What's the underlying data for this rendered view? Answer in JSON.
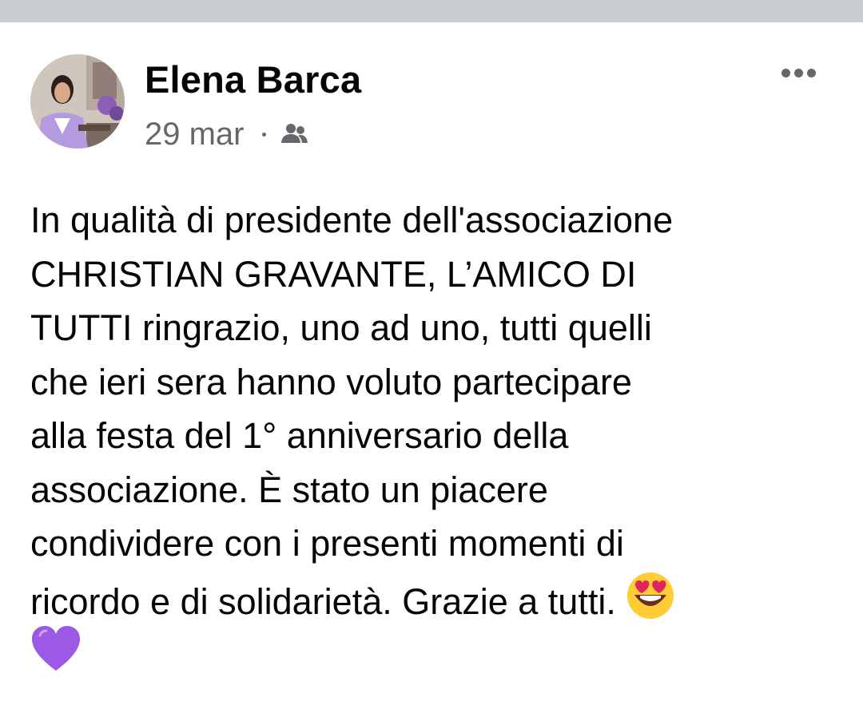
{
  "post": {
    "author": {
      "name": "Elena Barca",
      "avatar_icon": "profile-photo"
    },
    "date": "29 mar",
    "audience_icon": "friends-icon",
    "more_icon": "more-options-icon",
    "text_lines": [
      "In qualità di presidente dell'associazione",
      "CHRISTIAN GRAVANTE, L’AMICO DI",
      "TUTTI ringrazio, uno ad uno, tutti quelli",
      "che ieri sera hanno voluto partecipare",
      "alla festa del 1° anniversario della",
      "associazione. È stato un piacere",
      "condividere con i presenti momenti di",
      "ricordo e di solidarietà. Grazie a tutti. "
    ],
    "emojis": [
      "smiling-face-with-heart-eyes",
      "purple-heart"
    ]
  },
  "colors": {
    "top_strip": "#c9ccd1",
    "name": "#050505",
    "meta": "#65676b",
    "heart": "#9b59e6",
    "emoji_face": "#ffcc33",
    "emoji_heart_eyes": "#e0245e"
  }
}
